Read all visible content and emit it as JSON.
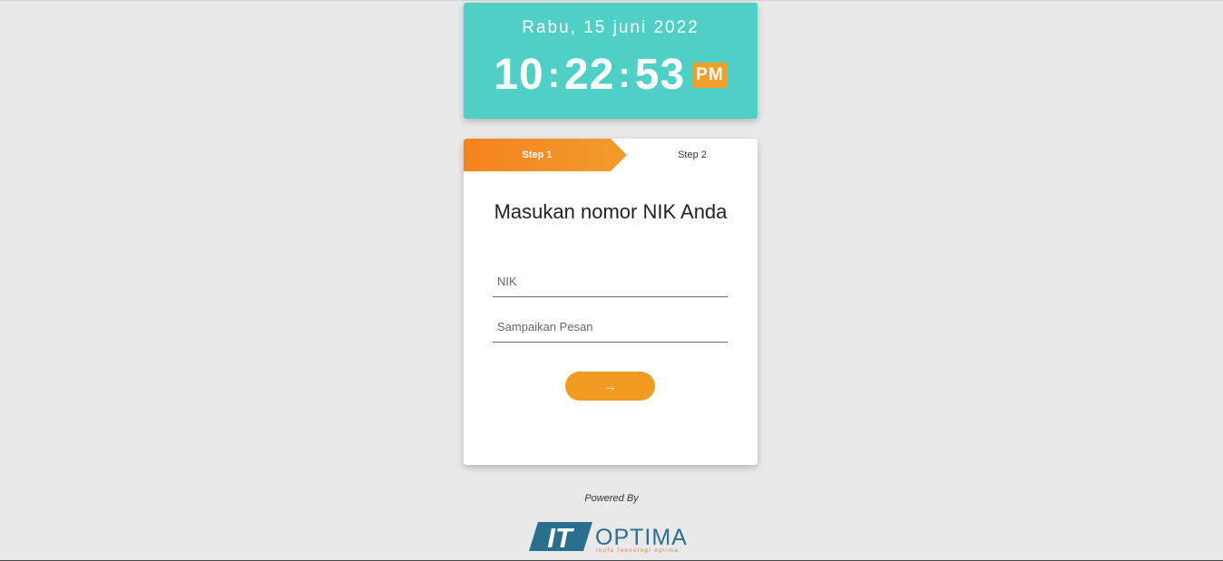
{
  "clock": {
    "date": "Rabu, 15 juni 2022",
    "hours": "10",
    "minutes": "22",
    "seconds": "53",
    "separator": ":",
    "ampm": "PM"
  },
  "steps": [
    {
      "label": "Step 1",
      "active": true
    },
    {
      "label": "Step 2",
      "active": false
    }
  ],
  "form": {
    "title": "Masukan nomor NIK Anda",
    "nik_placeholder": "NIK",
    "nik_value": "",
    "message_placeholder": "Sampaikan Pesan",
    "message_value": "",
    "next_label": "→"
  },
  "footer": {
    "powered_by": "Powered By",
    "logo": {
      "it": "IT",
      "name": "OPTIMA",
      "tagline": "inofa teknologi optima"
    }
  },
  "colors": {
    "clock_bg": "#4fcfc6",
    "accent_orange": "#f19b23",
    "page_bg": "#e9e9e9",
    "logo_blue": "#2a6f8c"
  }
}
